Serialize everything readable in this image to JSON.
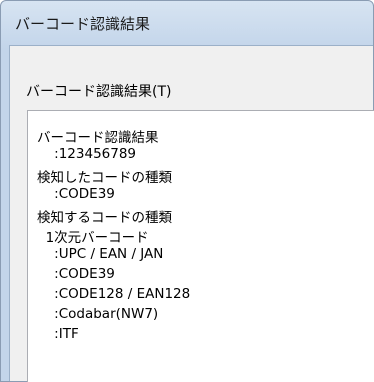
{
  "window": {
    "title": "バーコード認識結果"
  },
  "group": {
    "label": "バーコード認識結果(T)"
  },
  "result_lines": [
    "バーコード認識結果",
    "    :123456789",
    "検知したコードの種類",
    "    :CODE39",
    "検知するコードの種類",
    "  1次元バーコード",
    "    :UPC / EAN / JAN",
    "    :CODE39",
    "    :CODE128 / EAN128",
    "    :Codabar(NW7)",
    "    :ITF"
  ]
}
